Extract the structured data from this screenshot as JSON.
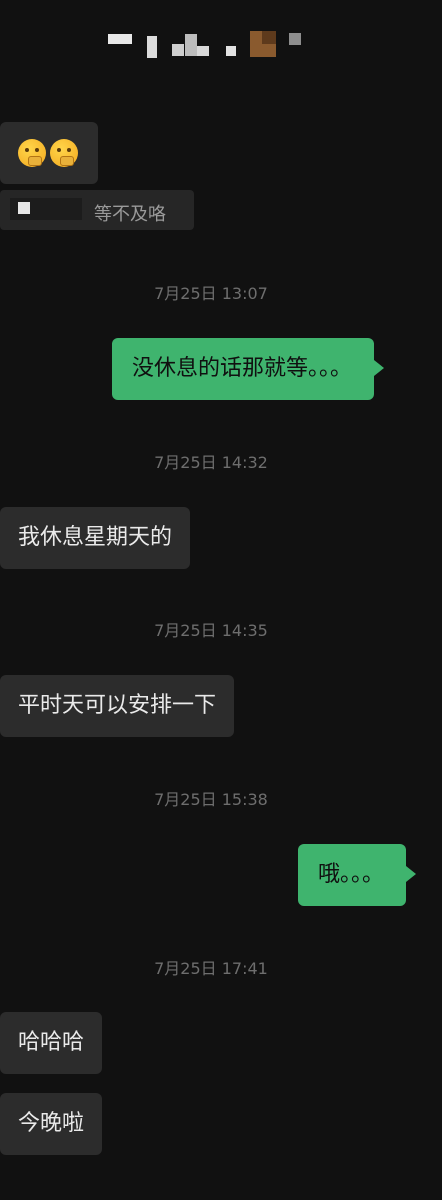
{
  "header": {
    "title_obscured": true
  },
  "messages": {
    "m1": {
      "emoji": [
        "thinking-face-icon",
        "thinking-face-icon"
      ]
    },
    "quote": {
      "text": "等不及咯"
    },
    "ts1": "7月25日 13:07",
    "m2": "没休息的话那就等。。。",
    "ts2": "7月25日 14:32",
    "m3": "我休息星期天的",
    "ts3": "7月25日 14:35",
    "m4": "平时天可以安排一下",
    "ts4": "7月25日 15:38",
    "m5": "哦。。。",
    "ts5": "7月25日 17:41",
    "m6": "哈哈哈",
    "m7": "今晚啦"
  },
  "colors": {
    "background": "#111111",
    "incoming_bubble": "#2c2c2c",
    "outgoing_bubble": "#3fb46e",
    "timestamp": "#6e6e6e"
  }
}
